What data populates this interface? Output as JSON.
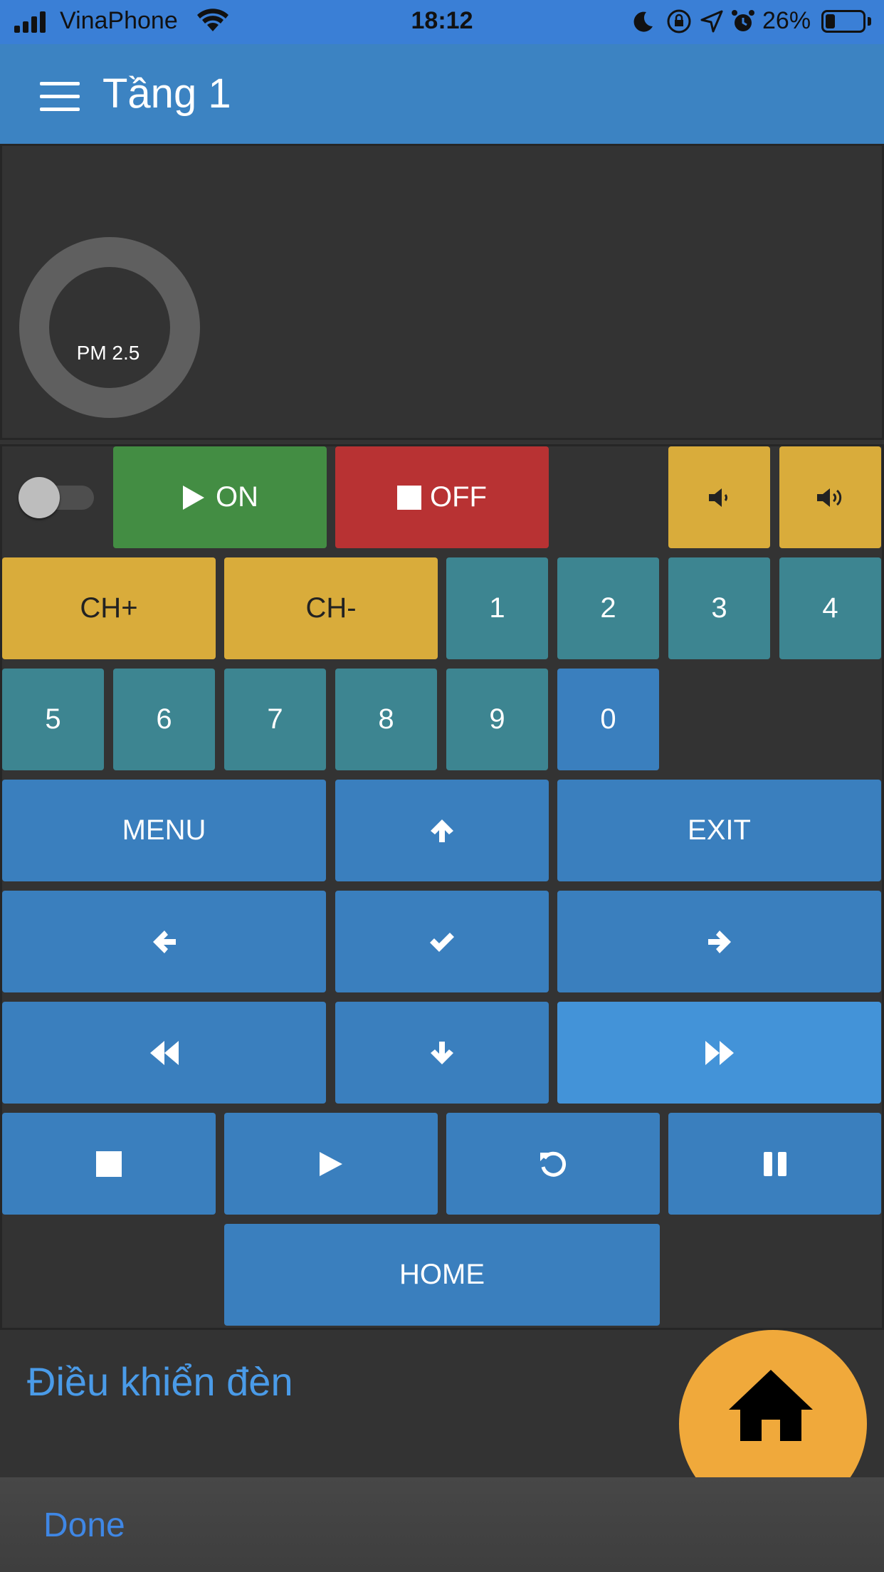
{
  "status_bar": {
    "carrier": "VinaPhone",
    "time": "18:12",
    "battery_percent": "26%",
    "battery_level": 0.26,
    "icons": [
      "signal-icon",
      "wifi-icon",
      "moon-icon",
      "rotation-lock-icon",
      "location-icon",
      "alarm-icon",
      "battery-icon"
    ]
  },
  "app_bar": {
    "title": "Tầng 1",
    "menu_icon": "hamburger-icon"
  },
  "gauge": {
    "label": "PM 2.5"
  },
  "remote": {
    "toggle_on": false,
    "on_label": "ON",
    "off_label": "OFF",
    "ch_plus": "CH+",
    "ch_minus": "CH-",
    "digits": [
      "1",
      "2",
      "3",
      "4",
      "5",
      "6",
      "7",
      "8",
      "9",
      "0"
    ],
    "menu_label": "MENU",
    "exit_label": "EXIT",
    "home_label": "HOME",
    "icons": {
      "volume_down": "volume-down-icon",
      "volume_up": "volume-up-icon",
      "up": "arrow-up-icon",
      "ok": "check-icon",
      "left": "arrow-left-icon",
      "right": "arrow-right-icon",
      "rewind": "rewind-icon",
      "down": "arrow-down-icon",
      "fast_forward": "fast-forward-icon",
      "stop": "stop-icon",
      "play": "play-icon",
      "replay": "replay-icon",
      "pause": "pause-icon"
    }
  },
  "lights_section": {
    "title": "Điều khiển đèn"
  },
  "fab": {
    "icon": "home-icon"
  },
  "keyboard_bar": {
    "done_label": "Done"
  },
  "colors": {
    "status_bar": "#3a7fd6",
    "app_bar": "#3c83c2",
    "background": "#333333",
    "teal": "#3d8591",
    "blue": "#3a7fbe",
    "blue_light": "#4393d8",
    "yellow": "#d9ac3b",
    "green": "#438d43",
    "red": "#b83233",
    "fab": "#f0a93b",
    "link": "#3f87e5"
  }
}
